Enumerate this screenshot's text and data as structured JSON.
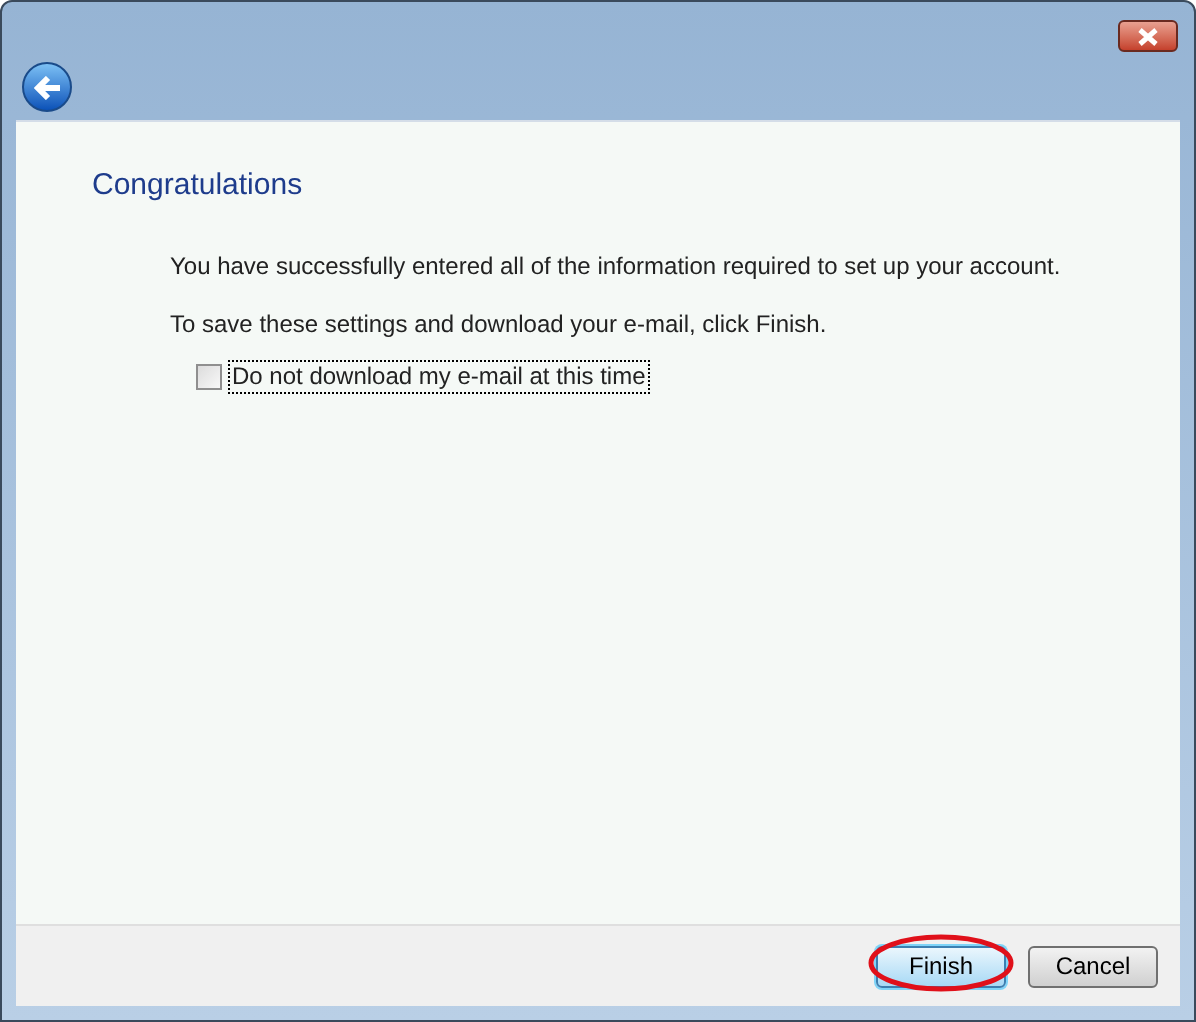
{
  "heading": "Congratulations",
  "paragraphs": [
    "You have successfully entered all of the information required to set up your account.",
    "To save these settings and download your e-mail, click Finish."
  ],
  "checkbox": {
    "label": "Do not download my e-mail at this time",
    "checked": false
  },
  "buttons": [
    {
      "label": "Finish",
      "default": true,
      "circled": true
    },
    {
      "label": "Cancel",
      "default": false,
      "circled": false
    }
  ]
}
